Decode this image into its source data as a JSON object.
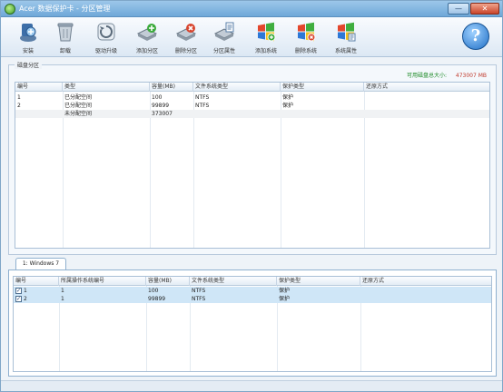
{
  "window": {
    "title": "Acer 数据保护卡 - 分区管理",
    "minimize_glyph": "—",
    "close_glyph": "✕"
  },
  "toolbar": {
    "buttons": [
      {
        "label": "安装",
        "icon": "install-icon"
      },
      {
        "label": "卸载",
        "icon": "uninstall-icon"
      },
      {
        "label": "驱动升级",
        "icon": "upgrade-icon"
      },
      {
        "label": "添加分区",
        "icon": "add-partition-icon"
      },
      {
        "label": "删除分区",
        "icon": "delete-partition-icon"
      },
      {
        "label": "分区属性",
        "icon": "partition-properties-icon"
      },
      {
        "label": "添加系统",
        "icon": "add-system-icon"
      },
      {
        "label": "删除系统",
        "icon": "delete-system-icon"
      },
      {
        "label": "系统属性",
        "icon": "system-properties-icon"
      }
    ],
    "help_glyph": "?"
  },
  "disk_group": {
    "label": "磁盘分区",
    "available_label": "可用磁盘总大小:",
    "available_value": "473007 MB",
    "columns": [
      "编号",
      "类型",
      "容量(MB)",
      "文件系统类型",
      "保护类型",
      "还原方式"
    ],
    "rows": [
      [
        "1",
        "已分配空间",
        "100",
        "NTFS",
        "保护",
        ""
      ],
      [
        "2",
        "已分配空间",
        "99899",
        "NTFS",
        "保护",
        ""
      ],
      [
        "",
        "未分配空间",
        "373007",
        "",
        "",
        ""
      ]
    ]
  },
  "system_tab": {
    "label": "1: Windows 7",
    "columns": [
      "编号",
      "所属操作系统编号",
      "容量(MB)",
      "文件系统类型",
      "保护类型",
      "还原方式"
    ],
    "rows": [
      {
        "checked": true,
        "cells": [
          "1",
          "1",
          "100",
          "NTFS",
          "保护",
          ""
        ]
      },
      {
        "checked": true,
        "cells": [
          "2",
          "1",
          "99899",
          "NTFS",
          "保护",
          ""
        ]
      }
    ]
  },
  "colors": {
    "title_bar": "#6fa8d8",
    "available_label": "#1d8a27",
    "available_value": "#c0392b",
    "selected_row": "#cfe6f7"
  }
}
